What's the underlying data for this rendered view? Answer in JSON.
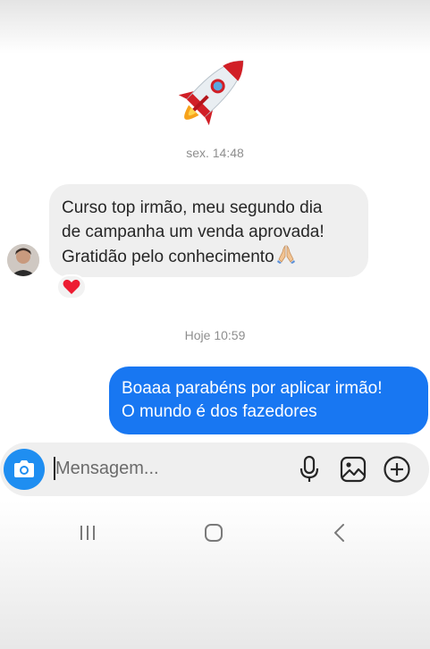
{
  "chat": {
    "emoji": "rocket",
    "timestamps": [
      "sex. 14:48",
      "Hoje 10:59"
    ],
    "incoming": {
      "lines": [
        "Curso top irmão, meu segundo dia",
        "de campanha um venda aprovada!",
        "Gratidão pelo conhecimento"
      ],
      "emoji": "folded-hands",
      "reaction": "heart"
    },
    "outgoing": {
      "lines": [
        "Boaaa parabéns por aplicar irmão!",
        "O mundo é dos fazedores"
      ]
    }
  },
  "composer": {
    "placeholder": "Mensagem...",
    "icons": [
      "camera-icon",
      "microphone-icon",
      "gallery-icon",
      "plus-circle-icon"
    ]
  },
  "colors": {
    "outgoing_bubble": "#1877f2",
    "camera_button": "#1f8ef1",
    "incoming_bubble": "#efefef",
    "timestamp": "#8e8e8e"
  }
}
